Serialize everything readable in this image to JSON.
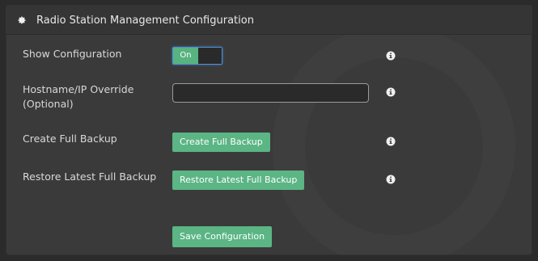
{
  "panel": {
    "title": "Radio Station Management Configuration",
    "header_icon": "gear-icon"
  },
  "fields": {
    "show_configuration": {
      "label": "Show Configuration",
      "toggle_label": "On",
      "state": "on",
      "info_icon": "info-icon"
    },
    "hostname_override": {
      "label_line1": "Hostname/IP Override",
      "label_line2": "(Optional)",
      "value": "",
      "info_icon": "info-icon"
    },
    "create_backup": {
      "label": "Create Full Backup",
      "button_label": "Create Full Backup",
      "info_icon": "info-icon"
    },
    "restore_backup": {
      "label": "Restore Latest Full Backup",
      "button_label": "Restore Latest Full Backup",
      "info_icon": "info-icon"
    }
  },
  "actions": {
    "save_label": "Save Configuration"
  },
  "colors": {
    "accent_green": "#5bb584",
    "focus_blue": "#4d90d6",
    "panel_bg": "#3a3a3a",
    "page_bg": "#2b2b2b"
  }
}
